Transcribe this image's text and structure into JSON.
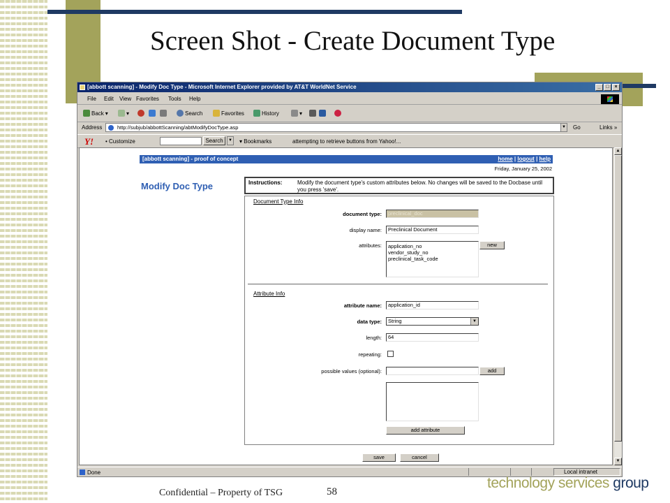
{
  "slide": {
    "title": "Screen Shot - Create Document Type",
    "footer": "Confidential – Property of TSG",
    "page_number": "58",
    "brand_prefix": "technology services ",
    "brand_suffix": "group",
    "colors": {
      "olive": "#a3a35b",
      "navy": "#1f3a63"
    }
  },
  "browser": {
    "title": "[abbott scanning] - Modify Doc Type - Microsoft Internet Explorer provided by AT&T WorldNet Service",
    "window_buttons": [
      "_",
      "□",
      "×"
    ],
    "menu": [
      "File",
      "Edit",
      "View",
      "Favorites",
      "Tools",
      "Help"
    ],
    "toolbar": {
      "back": "Back",
      "search": "Search",
      "favorites": "Favorites",
      "history": "History"
    },
    "address": {
      "label": "Address",
      "url": "http://subjub/abbottScanning/abtModifyDocType.asp",
      "go": "Go",
      "links": "Links »"
    },
    "yahoo": {
      "logo": "Y!",
      "customize": "• Customize",
      "search_button": "Search",
      "bookmarks": "▾ Bookmarks",
      "status": "attempting to retrieve buttons from Yahoo!..."
    },
    "status": {
      "left": "Done",
      "right": "Local intranet"
    },
    "icons": [
      "ie-icon",
      "back-icon",
      "forward-icon",
      "stop-icon",
      "refresh-icon",
      "home-icon",
      "search-icon",
      "favorites-icon",
      "history-icon",
      "mail-icon",
      "print-icon",
      "edit-icon"
    ]
  },
  "app": {
    "header_left": "[abbott scanning] - proof of concept",
    "nav": {
      "home": "home",
      "sep1": "|",
      "logout": "logout",
      "sep2": "|",
      "help": "help"
    },
    "date": "Friday, January 25, 2002",
    "heading": "Modify Doc Type",
    "instructions_label": "Instructions:",
    "instructions_text": "Modify the document type's custom attributes below.  No changes will be saved to the Docbase until you press 'save'.",
    "doc_type_section": {
      "title": "Document Type Info",
      "document_type_label": "document type:",
      "document_type_value": "preclinical_doc",
      "display_name_label": "display name:",
      "display_name_value": "Preclinical Document",
      "attributes_label": "attributes:",
      "attributes": [
        "application_no",
        "vendor_study_no",
        "preclinical_task_code"
      ],
      "new_button": "new"
    },
    "attr_section": {
      "title": "Attribute Info",
      "attribute_name_label": "attribute name:",
      "attribute_name_value": "application_id",
      "data_type_label": "data type:",
      "data_type_value": "String",
      "length_label": "length:",
      "length_value": "64",
      "repeating_label": "repeating:",
      "repeating_checked": false,
      "possible_values_label": "possible values (optional):",
      "possible_values_value": "",
      "add_button": "add",
      "add_attribute_button": "add attribute"
    },
    "save_button": "save",
    "cancel_button": "cancel"
  }
}
